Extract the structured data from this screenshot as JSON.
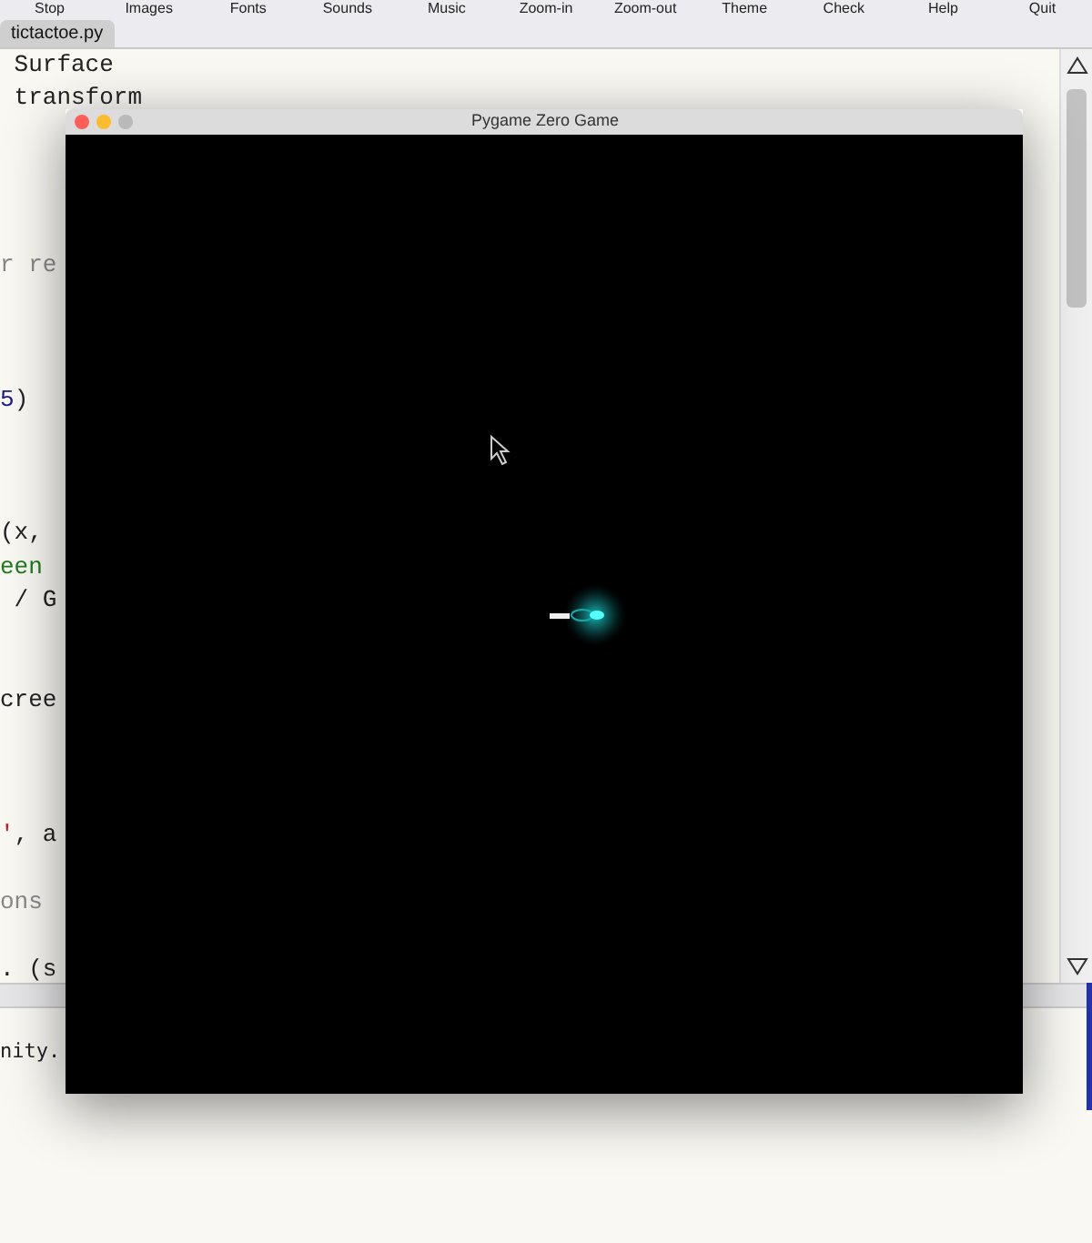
{
  "toolbar": [
    "Stop",
    "Images",
    "Fonts",
    "Sounds",
    "Music",
    "Zoom-in",
    "Zoom-out",
    "Theme",
    "Check",
    "Help",
    "Quit"
  ],
  "tabs": [
    {
      "label": "tictactoe.py",
      "selected": true
    }
  ],
  "code_lines": [
    {
      "kind": "code",
      "segments": [
        {
          "text": " Surface",
          "kind": "plain"
        }
      ]
    },
    {
      "kind": "code",
      "segments": [
        {
          "text": " transform",
          "kind": "plain"
        }
      ]
    },
    {
      "kind": "blank"
    },
    {
      "kind": "blank"
    },
    {
      "kind": "blank"
    },
    {
      "kind": "blank"
    },
    {
      "kind": "code",
      "segments": [
        {
          "text": "r re",
          "kind": "comment"
        }
      ]
    },
    {
      "kind": "blank"
    },
    {
      "kind": "blank"
    },
    {
      "kind": "blank"
    },
    {
      "kind": "code",
      "segments": [
        {
          "text": "5",
          "kind": "number"
        },
        {
          "text": ")",
          "kind": "plain"
        }
      ]
    },
    {
      "kind": "blank"
    },
    {
      "kind": "blank"
    },
    {
      "kind": "blank"
    },
    {
      "kind": "code",
      "segments": [
        {
          "text": "(x,",
          "kind": "plain"
        }
      ]
    },
    {
      "kind": "code",
      "segments": [
        {
          "text": "een",
          "kind": "string"
        }
      ]
    },
    {
      "kind": "code",
      "segments": [
        {
          "text": " / G",
          "kind": "plain"
        }
      ]
    },
    {
      "kind": "blank"
    },
    {
      "kind": "blank"
    },
    {
      "kind": "code",
      "segments": [
        {
          "text": "cree",
          "kind": "plain"
        }
      ]
    },
    {
      "kind": "blank"
    },
    {
      "kind": "blank"
    },
    {
      "kind": "blank"
    },
    {
      "kind": "code",
      "segments": [
        {
          "text": "'",
          "kind": "quote"
        },
        {
          "text": ", a",
          "kind": "plain"
        }
      ]
    },
    {
      "kind": "blank"
    },
    {
      "kind": "code",
      "segments": [
        {
          "text": "ons",
          "kind": "comment"
        }
      ]
    },
    {
      "kind": "blank"
    },
    {
      "kind": "code",
      "segments": [
        {
          "text": ". (s",
          "kind": "plain"
        }
      ]
    }
  ],
  "console_lines": [
    "nity."
  ],
  "game_window": {
    "title": "Pygame Zero Game"
  }
}
